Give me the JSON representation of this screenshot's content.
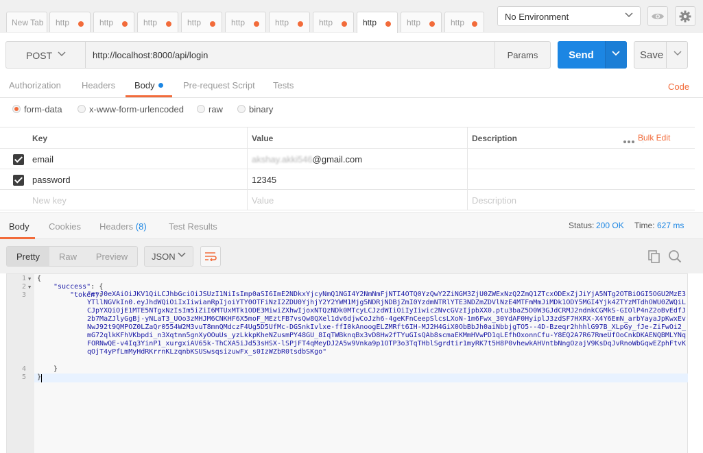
{
  "tabs": {
    "new_tab": "New Tab",
    "items": [
      {
        "label": "http",
        "active": false
      },
      {
        "label": "http",
        "active": false
      },
      {
        "label": "http",
        "active": false
      },
      {
        "label": "http",
        "active": false
      },
      {
        "label": "http",
        "active": false
      },
      {
        "label": "http",
        "active": false
      },
      {
        "label": "http",
        "active": false
      },
      {
        "label": "http",
        "active": true
      },
      {
        "label": "http",
        "active": false
      },
      {
        "label": "http",
        "active": false
      }
    ]
  },
  "environment": {
    "selected": "No Environment"
  },
  "request": {
    "method": "POST",
    "url": "http://localhost:8000/api/login",
    "params_label": "Params",
    "send_label": "Send",
    "save_label": "Save"
  },
  "request_tabs": {
    "authorization": "Authorization",
    "headers": "Headers",
    "body": "Body",
    "pre_request": "Pre-request Script",
    "tests": "Tests",
    "code": "Code"
  },
  "body_types": {
    "form_data": "form-data",
    "urlencoded": "x-www-form-urlencoded",
    "raw": "raw",
    "binary": "binary",
    "selected": "form-data"
  },
  "kv_table": {
    "headers": {
      "key": "Key",
      "value": "Value",
      "description": "Description"
    },
    "bulk_edit": "Bulk Edit",
    "rows": [
      {
        "key": "email",
        "value_blurred": "akshay.akki546",
        "value_visible": "@gmail.com",
        "checked": true
      },
      {
        "key": "password",
        "value": "12345",
        "checked": true
      }
    ],
    "placeholders": {
      "key": "New key",
      "value": "Value",
      "description": "Description"
    }
  },
  "response": {
    "tabs": {
      "body": "Body",
      "cookies": "Cookies",
      "headers": "Headers",
      "headers_count": "(8)",
      "test_results": "Test Results"
    },
    "status_label": "Status:",
    "status_value": "200 OK",
    "time_label": "Time:",
    "time_value": "627 ms",
    "views": {
      "pretty": "Pretty",
      "raw": "Raw",
      "preview": "Preview"
    },
    "format": "JSON",
    "code": {
      "line_numbers": [
        "1",
        "2",
        "3",
        "4",
        "5"
      ],
      "line1": "{",
      "success_key": "\"success\"",
      "token_key": "\"token\"",
      "token_value": "\"eyJ0eXAiOiJKV1QiLCJhbGciOiJSUzI1NiIsImp0aSI6ImE2NDkxYjcyNmQ1NGI4Y2NmNmFjNTI4OTQ0YzQwY2ZiNGM3ZjU0ZWExNzQ2ZmQ1ZTcxODExZjJiYjA5NTg2OTBiOGI5OGU2MzE3YTllNGVkIn0.eyJhdWQiOiIxIiwianRpIjoiYTY0OTFiNzI2ZDU0YjhjY2Y2YWM1Mjg5NDRjNDBjZmI0YzdmNTRlYTE3NDZmZDVlNzE4MTFmMmJiMDk1ODY5MGI4Yjk4ZTYzMTdhOWU0ZWQiLCJpYXQiOjE1MTE5NTgxNzIsIm5iZiI6MTUxMTk1ODE3MiwiZXhwIjoxNTQzNDk0MTcyLCJzdWIiOiIyIiwic2NvcGVzIjpbXX0.ptu3baZ5D0W3GJdCRMJ2ndnkCGMkS-GIOlP4nZ2oBvEdfJ2b7MaZJlyGgBj-yNLaT3_UOo3zMHJM6CNKHF6X5moF_MEztFB7vsQw8QXel1dv6djwCoJzh6-4geKFnCeepSlcsLXoN-1m6Fwx_30YdAF0HyiplJ3zdSF7HXRX-X4Y6EmN_arbYayaJpKwxEvNwJ92t9QMPOZ0LZaQr0554W2M3vuT8mnQMdczF4Ug5D5UfMc-DGSnkIvlxe-ffI0kAnoogELZMRft6IH-MJ2H4GiX0ObBbJh0aiNbbjgTO5--4D-Bzeqr2hhhlG97B_XLpGy_fJe-ZiFwOi2_mG72qlkKFhVKbpdi_n3Xqtnn5gnXyOOuUs_yzLkkpKheNZusmPY48GU_8IqTWBknqBx3vD8Hw2fTYuGIsQAb8scmaEKMmHVwPD1qLEfhOxonnCfu-Y8EQ2A7R67RmeUfOoCnkDKAENQBMLYNqFORNwQE-v4Iq3YinP1_xurgxiAV65k-ThCXA5iJd53sHSX-lSPjFT4qMeyDJ2A5w9Vnka9p1OTP3o3TqTHblSgrdtir1myRK7t5H8P0vhewkAHVntbNngOzajV9KsDqJvRnoWbGqwEZphFtvKqOjT4yPfLmMyHdRKrrnKLzqnbKSUSwsqsizuwFx_s0IzWZbR0tsdbSKgo\"",
      "line4": "}",
      "line5": "}"
    }
  }
}
